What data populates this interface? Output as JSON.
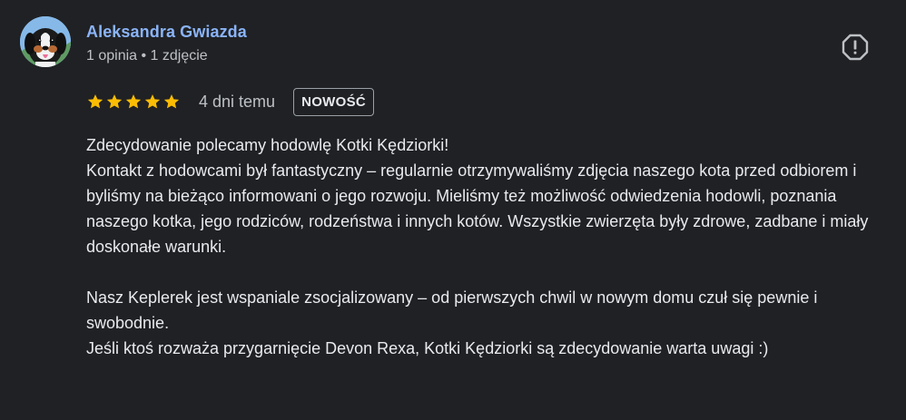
{
  "review": {
    "author": {
      "name": "Aleksandra Gwiazda",
      "meta": "1 opinia • 1 zdjęcie",
      "avatar_icon": "dog-avatar-icon"
    },
    "rating": {
      "stars": 5,
      "max_stars": 5,
      "star_color": "#fbbc04"
    },
    "date": "4 dni temu",
    "badge": "NOWOŚĆ",
    "report_icon": "report-icon",
    "text": "Zdecydowanie polecamy hodowlę Kotki Kędziorki!\nKontakt z hodowcami był fantastyczny – regularnie otrzymywaliśmy zdjęcia naszego kota przed odbiorem i byliśmy na bieżąco informowani o jego rozwoju. Mieliśmy też możliwość odwiedzenia hodowli, poznania naszego kotka, jego rodziców, rodzeństwa i innych kotów. Wszystkie zwierzęta były zdrowe, zadbane i miały doskonałe warunki.\n\nNasz Keplerek jest wspaniale zsocjalizowany – od pierwszych chwil w nowym domu czuł się pewnie i swobodnie.\nJeśli ktoś rozważa przygarnięcie Devon Rexa, Kotki Kędziorki są zdecydowanie warta uwagi :)"
  },
  "colors": {
    "background": "#202124",
    "author_name": "#8ab4f8",
    "text": "#e8eaed",
    "secondary_text": "#bdc1c6",
    "star": "#fbbc04"
  }
}
